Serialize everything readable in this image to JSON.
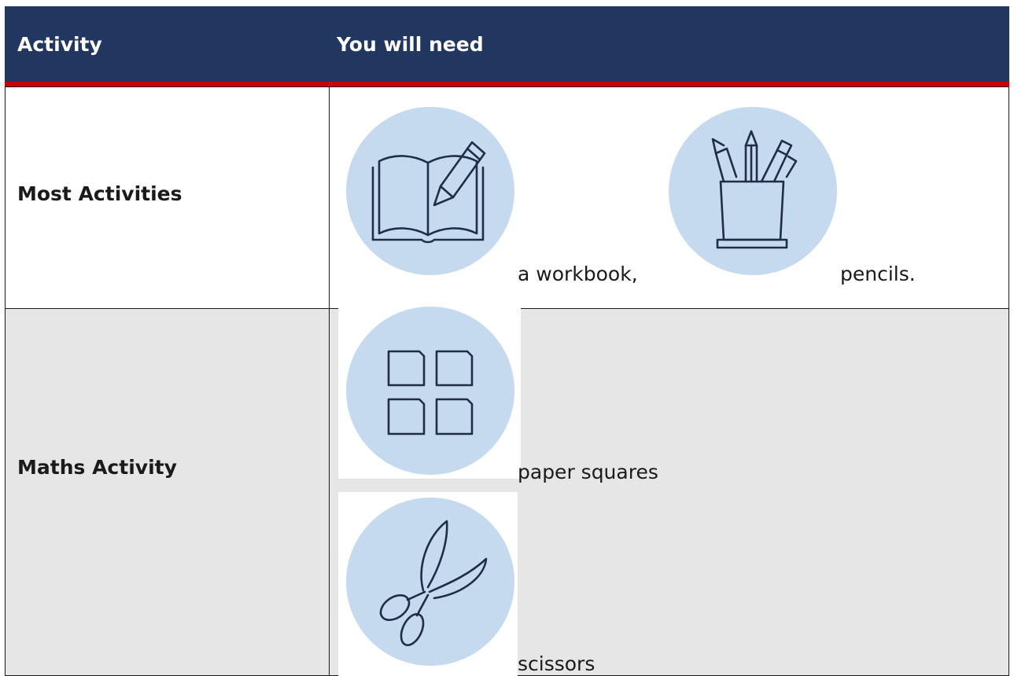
{
  "table": {
    "headers": {
      "activity": "Activity",
      "you_will_need": "You will need"
    },
    "rows": [
      {
        "activity": "Most Activities",
        "items": [
          {
            "text": "a workbook,",
            "icon": "workbook-icon"
          },
          {
            "text": "pencils.",
            "icon": "pencils-icon"
          }
        ]
      },
      {
        "activity": "Maths Activity",
        "items": [
          {
            "text": "paper squares",
            "icon": "paper-squares-icon"
          },
          {
            "text": "scissors",
            "icon": "scissors-icon"
          }
        ]
      }
    ]
  },
  "colors": {
    "header_bg": "#22375f",
    "header_underline": "#c8000a",
    "row_alt_bg": "#e6e6e6",
    "icon_circle": "#c5d9ef",
    "icon_stroke": "#1f2d45"
  }
}
